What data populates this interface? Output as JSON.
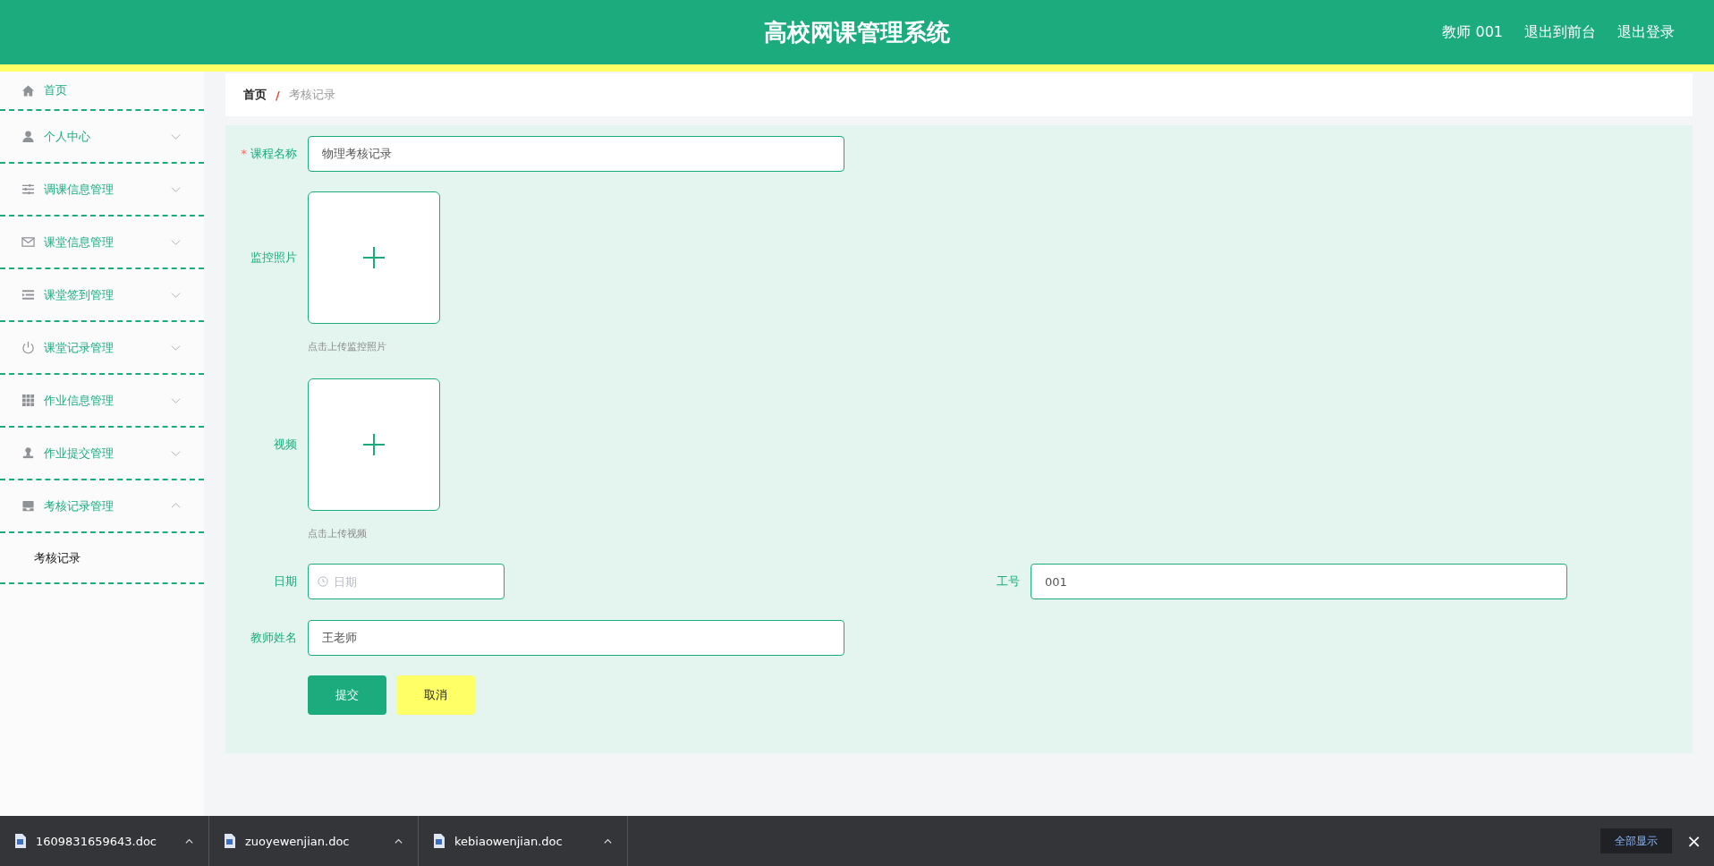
{
  "header": {
    "title": "高校网课管理系统",
    "links": [
      "教师 001",
      "退出到前台",
      "退出登录"
    ]
  },
  "sidebar": {
    "items": [
      {
        "label": "首页"
      },
      {
        "label": "个人中心",
        "expanded": false
      },
      {
        "label": "调课信息管理",
        "expanded": false
      },
      {
        "label": "课堂信息管理",
        "expanded": false
      },
      {
        "label": "课堂签到管理",
        "expanded": false
      },
      {
        "label": "课堂记录管理",
        "expanded": false
      },
      {
        "label": "作业信息管理",
        "expanded": false
      },
      {
        "label": "作业提交管理",
        "expanded": false
      },
      {
        "label": "考核记录管理",
        "expanded": true,
        "children": [
          {
            "label": "考核记录"
          }
        ]
      }
    ]
  },
  "breadcrumb": {
    "home": "首页",
    "separator": "/",
    "current": "考核记录"
  },
  "form": {
    "course": {
      "label": "课程名称",
      "required_mark": "*",
      "value": "物理考核记录"
    },
    "uploads": [
      {
        "label": "监控照片",
        "hint": "点击上传监控照片"
      },
      {
        "label": "视频",
        "hint": "点击上传视频"
      }
    ],
    "date": {
      "label": "日期",
      "placeholder": "日期"
    },
    "staff_no": {
      "label": "工号",
      "value": "001"
    },
    "teacher": {
      "label": "教师姓名",
      "value": "王老师"
    },
    "buttons": {
      "submit": "提交",
      "cancel": "取消"
    }
  },
  "downloads": {
    "files": [
      "1609831659643.doc",
      "zuoyewenjian.doc",
      "kebiaowenjian.doc"
    ],
    "show_all": "全部显示",
    "close": "×"
  }
}
